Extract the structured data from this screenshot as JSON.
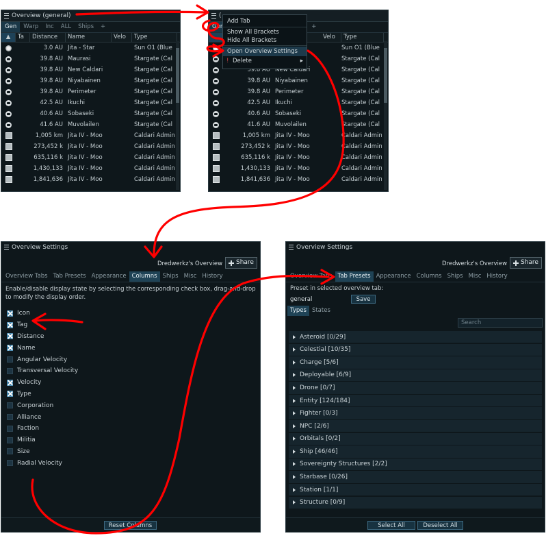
{
  "overview_window_1": {
    "title": "Overview (general)",
    "tabs": [
      "Gen",
      "Warp",
      "Inc",
      "ALL",
      "Ships",
      "+"
    ],
    "columns": [
      "",
      "Ta",
      "Distance",
      "Name",
      "Velo",
      "Type"
    ],
    "rows": [
      {
        "icon": "sun-icon",
        "distance": "3.0 AU",
        "name": "Jita - Star",
        "type": "Sun O1 (Blue"
      },
      {
        "icon": "stargate-icon",
        "distance": "39.8 AU",
        "name": "Maurasi",
        "type": "Stargate (Cal"
      },
      {
        "icon": "stargate-icon",
        "distance": "39.8 AU",
        "name": "New Caldari",
        "type": "Stargate (Cal"
      },
      {
        "icon": "stargate-icon",
        "distance": "39.8 AU",
        "name": "Niyabainen",
        "type": "Stargate (Cal"
      },
      {
        "icon": "stargate-icon",
        "distance": "39.8 AU",
        "name": "Perimeter",
        "type": "Stargate (Cal"
      },
      {
        "icon": "stargate-icon",
        "distance": "42.5 AU",
        "name": "Ikuchi",
        "type": "Stargate (Cal"
      },
      {
        "icon": "stargate-icon",
        "distance": "40.6 AU",
        "name": "Sobaseki",
        "type": "Stargate (Cal"
      },
      {
        "icon": "stargate-icon",
        "distance": "41.6 AU",
        "name": "Muvolailen",
        "type": "Stargate (Cal"
      },
      {
        "icon": "structure-icon",
        "distance": "1,005 km",
        "name": "Jita IV - Moo",
        "type": "Caldari Admin"
      },
      {
        "icon": "structure-icon",
        "distance": "273,452 k",
        "name": "Jita IV - Moo",
        "type": "Caldari Admin"
      },
      {
        "icon": "structure-icon",
        "distance": "635,116 k",
        "name": "Jita IV - Moo",
        "type": "Caldari Admin"
      },
      {
        "icon": "structure-icon",
        "distance": "1,430,133",
        "name": "Jita IV - Moo",
        "type": "Caldari Admin"
      },
      {
        "icon": "structure-icon",
        "distance": "1,841,636",
        "name": "Jita IV - Moo",
        "type": "Caldari Admin"
      }
    ]
  },
  "overview_window_2": {
    "title_fragment": "(",
    "tabs": [
      "Gen",
      "+"
    ],
    "columns": [
      "Velo",
      "Type"
    ],
    "context_menu": [
      "Add Tab",
      "Show All Brackets",
      "Hide All Brackets",
      "Open Overview Settings",
      "Delete"
    ],
    "rows": [
      {
        "distance": "",
        "name": "",
        "type": "Sun O1 (Blue"
      },
      {
        "distance": "",
        "name": "",
        "type": "Stargate (Cal"
      },
      {
        "distance": "39.8 AU",
        "name": "New Caldari",
        "type": "Stargate (Cal"
      },
      {
        "distance": "39.8 AU",
        "name": "Niyabainen",
        "type": "Stargate (Cal"
      },
      {
        "distance": "39.8 AU",
        "name": "Perimeter",
        "type": "Stargate (Cal"
      },
      {
        "distance": "42.5 AU",
        "name": "Ikuchi",
        "type": "Stargate (Cal"
      },
      {
        "distance": "40.6 AU",
        "name": "Sobaseki",
        "type": "Stargate (Cal"
      },
      {
        "distance": "41.6 AU",
        "name": "Muvolailen",
        "type": "Stargate (Cal"
      },
      {
        "distance": "1,005 km",
        "name": "Jita IV - Moo",
        "type": "Caldari Admin"
      },
      {
        "distance": "273,452 k",
        "name": "Jita IV - Moo",
        "type": "Caldari Admin"
      },
      {
        "distance": "635,116 k",
        "name": "Jita IV - Moo",
        "type": "Caldari Admin"
      },
      {
        "distance": "1,430,133",
        "name": "Jita IV - Moo",
        "type": "Caldari Admin"
      },
      {
        "distance": "1,841,636",
        "name": "Jita IV - Moo",
        "type": "Caldari Admin"
      }
    ]
  },
  "settings_columns": {
    "title": "Overview Settings",
    "owner": "Dredwerkz's Overview",
    "share_label": "Share",
    "subtabs": [
      "Overview Tabs",
      "Tab Presets",
      "Appearance",
      "Columns",
      "Ships",
      "Misc",
      "History"
    ],
    "description": "Enable/disable display state by selecting the corresponding check box, drag-and-drop to modify the display order.",
    "items": [
      {
        "label": "Icon",
        "checked": true
      },
      {
        "label": "Tag",
        "checked": true
      },
      {
        "label": "Distance",
        "checked": true
      },
      {
        "label": "Name",
        "checked": true
      },
      {
        "label": "Angular Velocity",
        "checked": false
      },
      {
        "label": "Transversal Velocity",
        "checked": false
      },
      {
        "label": "Velocity",
        "checked": true
      },
      {
        "label": "Type",
        "checked": true
      },
      {
        "label": "Corporation",
        "checked": false
      },
      {
        "label": "Alliance",
        "checked": false
      },
      {
        "label": "Faction",
        "checked": false
      },
      {
        "label": "Militia",
        "checked": false
      },
      {
        "label": "Size",
        "checked": false
      },
      {
        "label": "Radial Velocity",
        "checked": false
      }
    ],
    "reset_label": "Reset Columns"
  },
  "settings_presets": {
    "title": "Overview Settings",
    "owner": "Dredwerkz's Overview",
    "share_label": "Share",
    "subtabs": [
      "Overview Tabs",
      "Tab Presets",
      "Appearance",
      "Columns",
      "Ships",
      "Misc",
      "History"
    ],
    "preset_label": "Preset in selected overview tab:",
    "preset_value": "general",
    "save_label": "Save",
    "type_tabs": [
      "Types",
      "States"
    ],
    "search_placeholder": "Search",
    "groups": [
      "Asteroid [0/29]",
      "Celestial [10/35]",
      "Charge [5/6]",
      "Deployable [6/9]",
      "Drone [0/7]",
      "Entity [124/184]",
      "Fighter [0/3]",
      "NPC [2/6]",
      "Orbitals [0/2]",
      "Ship [46/46]",
      "Sovereignty Structures [2/2]",
      "Starbase [0/26]",
      "Station [1/1]",
      "Structure [0/9]"
    ],
    "select_all_label": "Select All",
    "deselect_all_label": "Deselect All"
  },
  "colors": {
    "annotation": "#ff0000",
    "active_tab": "#1f4356",
    "panel": "#0e171b"
  }
}
